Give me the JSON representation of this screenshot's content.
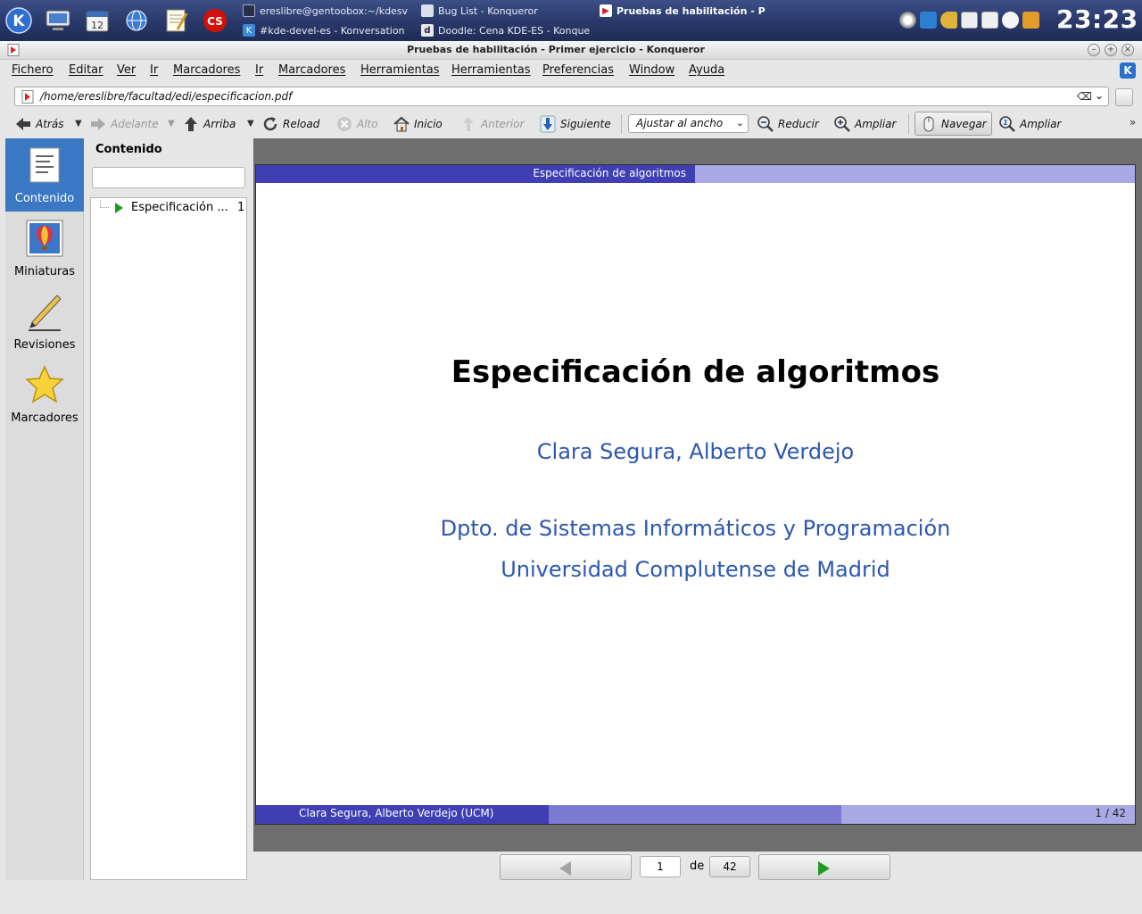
{
  "taskbar": {
    "launchers": [
      "kde-menu-icon",
      "computer-icon",
      "calendar-icon",
      "network-globe-icon",
      "text-editor-icon",
      "lastfm-icon"
    ],
    "calendar_day": "12",
    "lastfm_label": "CS",
    "tasks": [
      {
        "label": "ereslibre@gentoobox:~/kdesv",
        "icon": "terminal-icon",
        "active": false
      },
      {
        "label": "Bug List - Konqueror",
        "icon": "browser-icon",
        "active": false
      },
      {
        "label": "Pruebas de habilitación - P",
        "icon": "pdf-icon",
        "active": true
      },
      {
        "label": "#kde-devel-es - Konversation",
        "icon": "konversation-icon",
        "active": false
      },
      {
        "label": "Doodle: Cena KDE-ES - Konque",
        "icon": "doodle-icon",
        "active": false
      }
    ],
    "tray": [
      "eye-icon",
      "kde-update-icon",
      "key-icon",
      "clipboard-icon",
      "notes-icon",
      "cloud-icon",
      "folder-icon"
    ],
    "clock": "23:23"
  },
  "window": {
    "title": "Pruebas de habilitación - Primer ejercicio - Konqueror",
    "buttons": [
      "minimize",
      "maximize",
      "close"
    ]
  },
  "menu": [
    "Fichero",
    "Editar",
    "Ver",
    "Ir",
    "Marcadores",
    "Ir",
    "Marcadores",
    "Herramientas",
    "Herramientas",
    "Preferencias",
    "Window",
    "Ayuda"
  ],
  "location": {
    "url": "/home/ereslibre/facultad/edi/especificacion.pdf"
  },
  "toolbar": {
    "back": "Atrás",
    "forward": "Adelante",
    "up": "Arriba",
    "reload": "Reload",
    "stop": "Alto",
    "home": "Inicio",
    "previous": "Anterior",
    "next": "Siguiente",
    "zoom_mode": "Ajustar al ancho",
    "zoom_out": "Reducir",
    "zoom_in": "Ampliar",
    "browse": "Navegar",
    "magnify": "Ampliar"
  },
  "sidebar": {
    "tabs": [
      {
        "label": "Contenido",
        "icon": "contents-icon",
        "active": true
      },
      {
        "label": "Miniaturas",
        "icon": "thumbnails-icon",
        "active": false
      },
      {
        "label": "Revisiones",
        "icon": "pencil-icon",
        "active": false
      },
      {
        "label": "Marcadores",
        "icon": "star-icon",
        "active": false
      }
    ]
  },
  "contents": {
    "title": "Contenido",
    "search_value": "",
    "items": [
      {
        "label": "Especificación ...",
        "page": "1"
      }
    ]
  },
  "slide": {
    "header": "Especificación de algoritmos",
    "title": "Especificación de algoritmos",
    "authors": "Clara Segura, Alberto Verdejo",
    "department": "Dpto. de Sistemas Informáticos y Programación",
    "university": "Universidad Complutense de Madrid",
    "footer_authors": "Clara Segura, Alberto Verdejo  (UCM)",
    "footer_page": "1 / 42"
  },
  "pager": {
    "current": "1",
    "of": "de",
    "total": "42"
  },
  "colors": {
    "beamer_dark": "#3f3fb3",
    "beamer_mid": "#7a7ad2",
    "beamer_light": "#a9a9e6",
    "slide_blue_text": "#2d57b0",
    "sidebar_active": "#3a78c4"
  }
}
